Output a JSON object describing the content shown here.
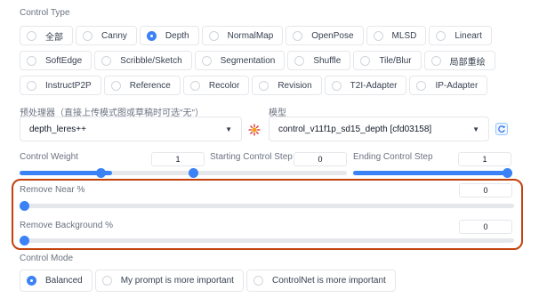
{
  "control_type": {
    "label": "Control Type",
    "rows": [
      [
        {
          "label": "全部",
          "checked": false
        },
        {
          "label": "Canny",
          "checked": false
        },
        {
          "label": "Depth",
          "checked": true
        },
        {
          "label": "NormalMap",
          "checked": false
        },
        {
          "label": "OpenPose",
          "checked": false
        },
        {
          "label": "MLSD",
          "checked": false
        },
        {
          "label": "Lineart",
          "checked": false
        }
      ],
      [
        {
          "label": "SoftEdge",
          "checked": false
        },
        {
          "label": "Scribble/Sketch",
          "checked": false
        },
        {
          "label": "Segmentation",
          "checked": false
        },
        {
          "label": "Shuffle",
          "checked": false
        },
        {
          "label": "Tile/Blur",
          "checked": false
        },
        {
          "label": "局部重绘",
          "checked": false
        }
      ],
      [
        {
          "label": "InstructP2P",
          "checked": false
        },
        {
          "label": "Reference",
          "checked": false
        },
        {
          "label": "Recolor",
          "checked": false
        },
        {
          "label": "Revision",
          "checked": false
        },
        {
          "label": "T2I-Adapter",
          "checked": false
        },
        {
          "label": "IP-Adapter",
          "checked": false
        }
      ]
    ]
  },
  "preprocessor": {
    "label": "预处理器（直接上传模式图或草稿时可选\"无\"）",
    "value": "depth_leres++"
  },
  "model": {
    "label": "模型",
    "value": "control_v11f1p_sd15_depth [cfd03158]"
  },
  "sliders_top": {
    "control_weight": {
      "label": "Control Weight",
      "value": "1",
      "fraction": 0.5
    },
    "starting_step": {
      "label": "Starting Control Step",
      "value": "0",
      "fraction": 0.0
    },
    "ending_step": {
      "label": "Ending Control Step",
      "value": "1",
      "fraction": 1.0
    }
  },
  "remove_near": {
    "label": "Remove Near %",
    "value": "0",
    "fraction": 0.0
  },
  "remove_background": {
    "label": "Remove Background %",
    "value": "0",
    "fraction": 0.0
  },
  "control_mode": {
    "label": "Control Mode",
    "options": [
      {
        "label": "Balanced",
        "checked": true
      },
      {
        "label": "My prompt is more important",
        "checked": false
      },
      {
        "label": "ControlNet is more important",
        "checked": false
      }
    ]
  },
  "colors": {
    "accent": "#3b82f6",
    "highlight": "#c2410c"
  }
}
